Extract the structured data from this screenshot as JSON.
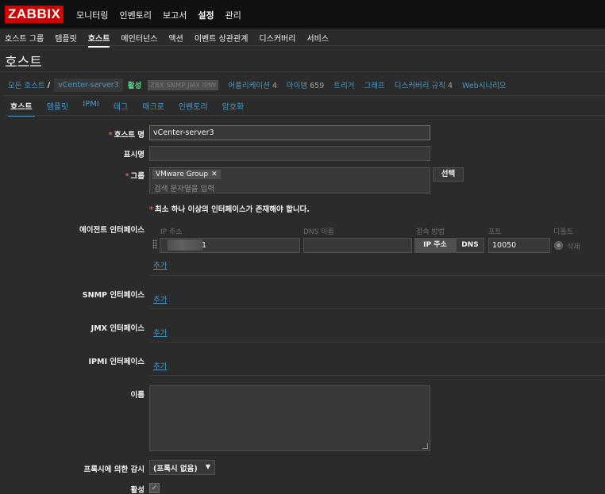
{
  "logo": "ZABBIX",
  "top_menu": [
    "모니터링",
    "인벤토리",
    "보고서",
    "설정",
    "관리"
  ],
  "sub_menu": [
    "호스트 그룹",
    "템플릿",
    "호스트",
    "메인터넌스",
    "액션",
    "이벤트 상관관계",
    "디스커버리",
    "서비스"
  ],
  "page_title": "호스트",
  "nav": {
    "all_hosts": "모든 호스트",
    "separator": "/",
    "current_host": "vCenter-server3",
    "status": "활성",
    "availability": "ZBX SNMP JMX IPMI",
    "applications": "어플리케이션",
    "applications_count": "4",
    "items": "아이템",
    "items_count": "659",
    "triggers": "트리거",
    "graphs": "그래프",
    "discovery_rules": "디스커버리 규칙",
    "discovery_rules_count": "4",
    "web_scenarios": "Web시나리오"
  },
  "tabs": [
    "호스트",
    "템플릿",
    "IPMI",
    "태그",
    "매크로",
    "인벤토리",
    "암호화"
  ],
  "form": {
    "hostname_label": "호스트 명",
    "hostname_value": "vCenter-server3",
    "visible_name_label": "표시명",
    "visible_name_value": "",
    "groups_label": "그룹",
    "group_chip": "VMware Group",
    "group_remove": "✕",
    "groups_placeholder": "검색 문자열을 입력",
    "select_button": "선택",
    "interface_warning": "최소 하나 이상의 인터페이스가 존재해야 합니다.",
    "agent_if_label": "에이전트 인터페이스",
    "col_ip": "IP 주소",
    "col_dns": "DNS 이름",
    "col_connect": "접속 방법",
    "col_port": "포트",
    "col_default": "디폴트",
    "agent_ip_suffix": "1",
    "agent_dns": "",
    "connect_ip": "IP 주소",
    "connect_dns": "DNS",
    "agent_port": "10050",
    "delete_link": "삭제",
    "add_link": "추가",
    "snmp_if_label": "SNMP 인터페이스",
    "jmx_if_label": "JMX 인터페이스",
    "ipmi_if_label": "IPMI 인터페이스",
    "description_label": "이름",
    "proxy_label": "프록시에 의한 감시",
    "proxy_value": "(프록시 없음)",
    "proxy_arrow": "▼",
    "enabled_label": "활성",
    "enabled_check": "✓",
    "required_mark": "*"
  },
  "colors": {
    "brand": "#d40000",
    "link": "#4796c4",
    "status_active": "#59db8f",
    "required": "#e45959",
    "background": "#2b2b2b"
  }
}
